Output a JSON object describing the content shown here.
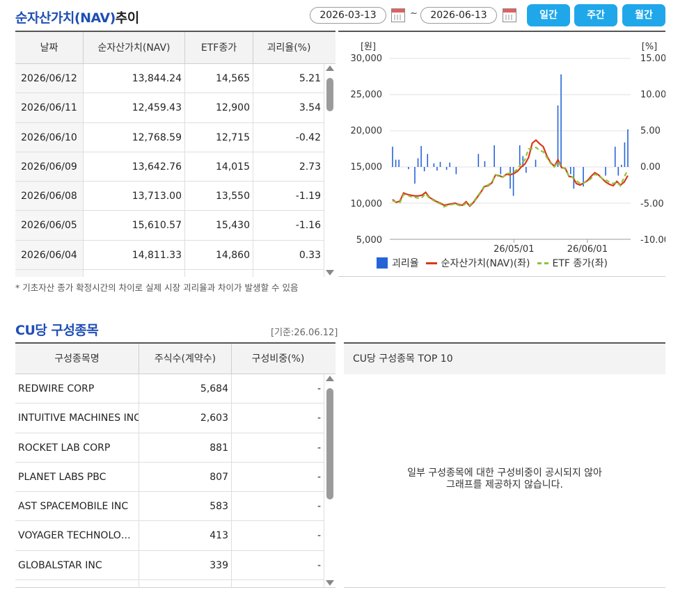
{
  "nav_section": {
    "title_blue": "순자산가치(NAV)",
    "title_dark": "추이",
    "start_date": "2026-03-13",
    "tilde": "~",
    "end_date": "2026-06-13",
    "period_buttons": [
      "일간",
      "주간",
      "월간"
    ]
  },
  "nav_table": {
    "headers": [
      "날짜",
      "순자산가치(NAV)",
      "ETF종가",
      "괴리율(%)"
    ],
    "rows": [
      [
        "2026/06/12",
        "13,844.24",
        "14,565",
        "5.21"
      ],
      [
        "2026/06/11",
        "12,459.43",
        "12,900",
        "3.54"
      ],
      [
        "2026/06/10",
        "12,768.59",
        "12,715",
        "-0.42"
      ],
      [
        "2026/06/09",
        "13,642.76",
        "14,015",
        "2.73"
      ],
      [
        "2026/06/08",
        "13,713.00",
        "13,550",
        "-1.19"
      ],
      [
        "2026/06/05",
        "15,610.57",
        "15,430",
        "-1.16"
      ],
      [
        "2026/06/04",
        "14,811.33",
        "14,860",
        "0.33"
      ]
    ]
  },
  "note": "* 기초자산 종가 확정시간의 차이로 실제 시장 괴리율과 차이가 발생할 수 있음",
  "cu_section": {
    "title": "CU당 구성종목",
    "basis": "[기준:26.06.12]",
    "headers": [
      "구성종목명",
      "주식수(계약수)",
      "구성비중(%)"
    ],
    "rows": [
      [
        "REDWIRE CORP",
        "5,684",
        "-"
      ],
      [
        "INTUITIVE MACHINES INC",
        "2,603",
        "-"
      ],
      [
        "ROCKET LAB CORP",
        "881",
        "-"
      ],
      [
        "PLANET LABS PBC",
        "807",
        "-"
      ],
      [
        "AST SPACEMOBILE INC",
        "583",
        "-"
      ],
      [
        "VOYAGER TECHNOLO…",
        "413",
        "-"
      ],
      [
        "GLOBALSTAR INC",
        "339",
        "-"
      ]
    ],
    "top10_title": "CU당 구성종목 TOP 10",
    "top10_message_line1": "일부 구성종목에 대한 구성비중이 공시되지 않아",
    "top10_message_line2": "그래프를 제공하지 않습니다."
  },
  "colors": {
    "accent_blue": "#1f4eb5",
    "button_blue": "#1fa7ea",
    "bar_blue": "#2563d9",
    "nav_line": "#d9361a",
    "etf_line": "#8cc43a"
  },
  "chart_data": {
    "type": "bar+line",
    "left_unit_label": "[원]",
    "right_unit_label": "[%]",
    "left_ticks": [
      "30,000",
      "25,000",
      "20,000",
      "15,000",
      "10,000",
      "5,000"
    ],
    "right_ticks": [
      "15.00",
      "10.00",
      "5.00",
      "0.00",
      "-5.00",
      "-10.00"
    ],
    "left_range": [
      5000,
      30000
    ],
    "right_range": [
      -10,
      15
    ],
    "x_tick_labels": [
      "26/05/01",
      "26/06/01"
    ],
    "x_tick_index": [
      33,
      53
    ],
    "legend": [
      "괴리율",
      "순자산가치(NAV)(좌)",
      "ETF 종가(좌)"
    ],
    "series": [
      {
        "name": "괴리율",
        "kind": "bar",
        "values": [
          2.8,
          1.0,
          1.0,
          0,
          0,
          -0.3,
          0,
          -2.3,
          1.2,
          2.9,
          -0.6,
          1.8,
          0,
          0.5,
          -0.5,
          0.7,
          0,
          -0.4,
          0.6,
          0,
          -1.0,
          0,
          0,
          0,
          0,
          0,
          0,
          1.8,
          0,
          0.8,
          0,
          0,
          3.0,
          0,
          -1.0,
          0,
          0,
          -3.0,
          -4.0,
          0,
          3.0,
          1.5,
          -0.8,
          0,
          0,
          1.0,
          0,
          0,
          0,
          0,
          0,
          0,
          8.5,
          12.8,
          0,
          0,
          -1.0,
          -3.0,
          0,
          0,
          -2.7,
          0,
          0,
          0,
          0,
          0,
          0,
          -1.2,
          0,
          0,
          2.8,
          -1.2,
          0.3,
          3.4,
          5.2
        ]
      },
      {
        "name": "순자산가치(NAV)(좌)",
        "kind": "line",
        "values": [
          10500,
          10100,
          10300,
          11400,
          11200,
          11100,
          11000,
          11000,
          11100,
          11500,
          10800,
          10500,
          10200,
          10000,
          9700,
          9800,
          9900,
          10000,
          9800,
          9700,
          10200,
          9600,
          10100,
          10800,
          11500,
          12300,
          12400,
          12800,
          13900,
          13800,
          13600,
          14000,
          13900,
          14100,
          14400,
          15000,
          15400,
          16300,
          18300,
          18700,
          18200,
          17800,
          16500,
          15600,
          15100,
          16000,
          14900,
          14800,
          13700,
          13600,
          12700,
          12500,
          12800,
          13100,
          13700,
          14200,
          13900,
          13400,
          12900,
          12600,
          12400,
          13000,
          12500,
          12900,
          13800
        ]
      },
      {
        "name": "ETF 종가(좌)",
        "kind": "line",
        "values": [
          10300,
          10200,
          10100,
          11200,
          11100,
          10900,
          10800,
          10700,
          10800,
          11300,
          10700,
          10400,
          10100,
          9900,
          9500,
          9700,
          9800,
          9900,
          9700,
          9600,
          10000,
          9700,
          10200,
          10900,
          11600,
          12400,
          12500,
          12900,
          13900,
          13700,
          13600,
          14100,
          14100,
          14300,
          14700,
          15500,
          16000,
          17500,
          17500,
          17700,
          17300,
          17100,
          16300,
          15500,
          15000,
          15700,
          15000,
          14700,
          13700,
          13600,
          13100,
          12700,
          12800,
          13000,
          13400,
          14000,
          13800,
          13400,
          13200,
          12900,
          12700,
          12900,
          12400,
          13600,
          14600
        ]
      }
    ]
  }
}
